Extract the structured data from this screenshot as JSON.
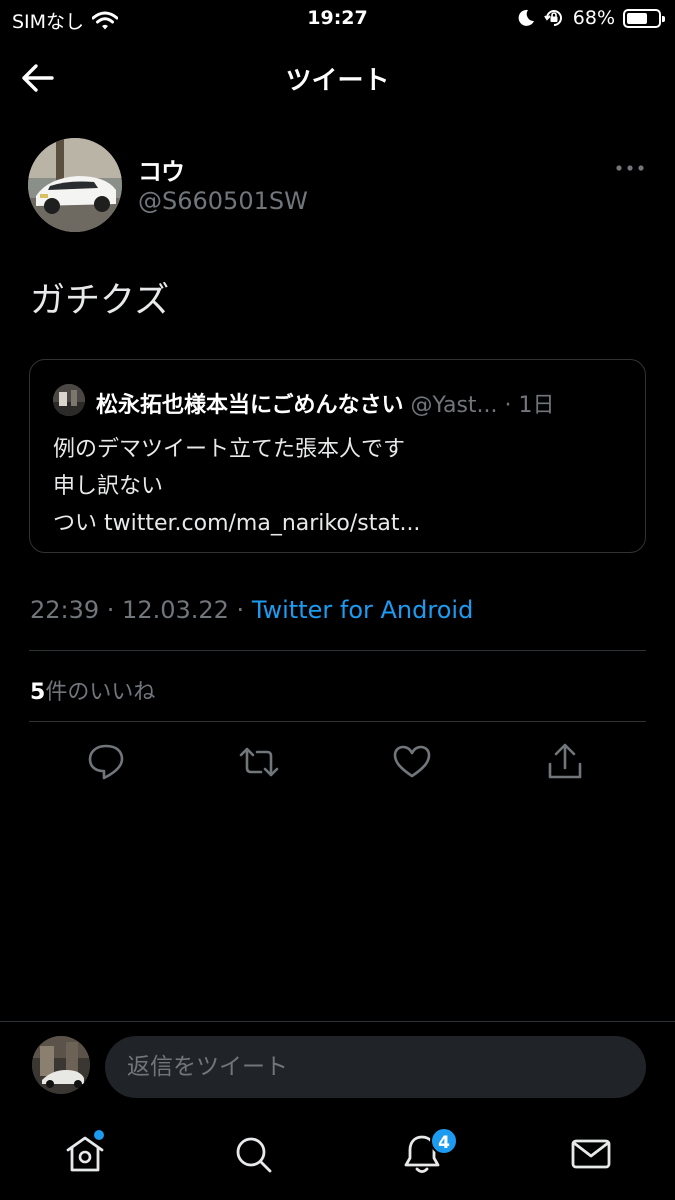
{
  "status_bar": {
    "carrier": "SIMなし",
    "time": "19:27",
    "battery_percent_label": "68%",
    "battery_level": 0.68
  },
  "header": {
    "title": "ツイート"
  },
  "tweet": {
    "author_name": "コウ",
    "author_handle": "@S660501SW",
    "text": "ガチクズ",
    "timestamp": "22:39 · 12.03.22 · ",
    "source": "Twitter for Android",
    "likes_count": "5",
    "likes_label": "件のいいね"
  },
  "quote": {
    "author_name": "松永拓也様本当にごめんなさい",
    "handle_and_time": " @Yast... · 1日",
    "lines": [
      "例のデマツイート立てた張本人です",
      "申し訳ない",
      "つい twitter.com/ma_nariko/stat..."
    ]
  },
  "reply": {
    "placeholder": "返信をツイート"
  },
  "tab_bar": {
    "notifications_badge": "4"
  },
  "colors": {
    "accent": "#1d9bf0",
    "background": "#000000",
    "secondary_text": "#71767b",
    "divider": "#2f3336"
  },
  "icons": [
    "wifi-icon",
    "moon-icon",
    "orientation-lock-icon",
    "battery-icon",
    "back-arrow-icon",
    "more-icon",
    "reply-icon",
    "retweet-icon",
    "like-icon",
    "share-icon",
    "home-icon",
    "search-icon",
    "notifications-icon",
    "messages-icon"
  ]
}
